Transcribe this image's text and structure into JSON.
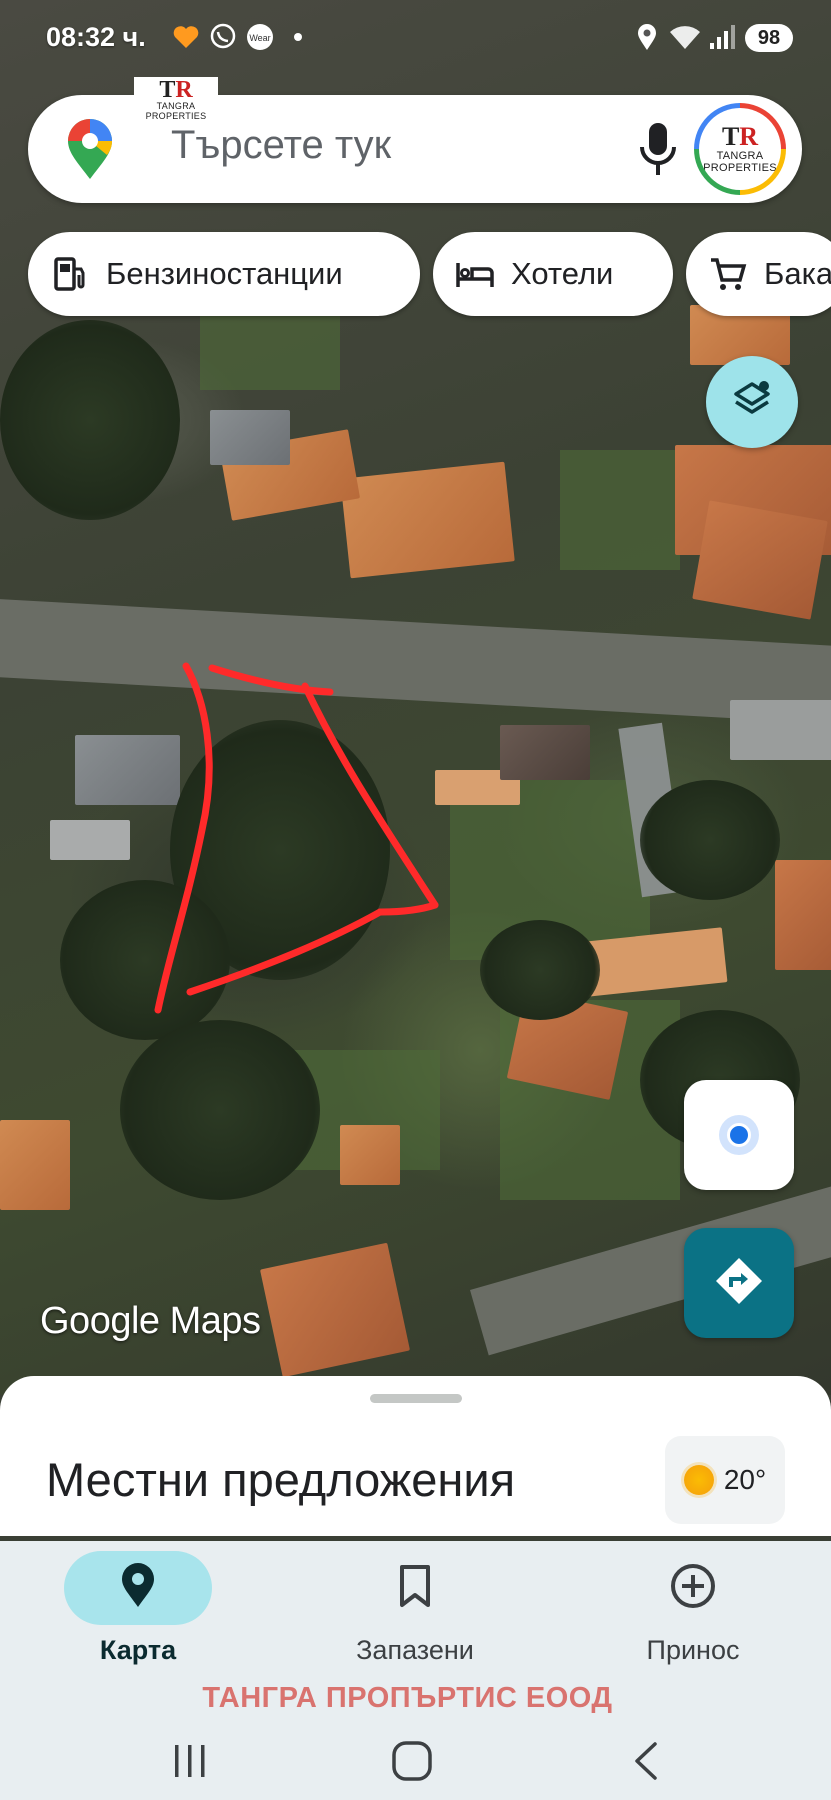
{
  "status_bar": {
    "time": "08:32 ч.",
    "icons": [
      "heart-app-icon",
      "viber-icon",
      "wear-icon",
      "dot-icon",
      "location-icon",
      "wifi-icon",
      "signal-icon"
    ],
    "battery": "98"
  },
  "search": {
    "placeholder": "Търсете тук",
    "icons": [
      "maps-pin-icon",
      "mic-icon"
    ],
    "avatar": {
      "mark_left": "T",
      "mark_right": "R",
      "brand": "TANGRA",
      "sub": "PROPERTIES"
    }
  },
  "overlay_logo": {
    "mark_left": "T",
    "mark_right": "R",
    "line1": "TANGRA",
    "line2": "PROPERTIES"
  },
  "chips": [
    {
      "label": "Бензиностанции",
      "icon": "gas-station-icon"
    },
    {
      "label": "Хотели",
      "icon": "bed-icon"
    },
    {
      "label": "Бака",
      "icon": "cart-icon"
    }
  ],
  "map": {
    "attribution": "Google Maps",
    "annotation_color": "#ff2a2a",
    "floating_buttons": [
      "layers-icon",
      "my-location-icon",
      "directions-icon"
    ]
  },
  "sheet": {
    "title": "Местни предложения",
    "weather_temp": "20°"
  },
  "bottom_nav": [
    {
      "label": "Карта",
      "icon": "pin-icon",
      "active": true
    },
    {
      "label": "Запазени",
      "icon": "bookmark-icon",
      "active": false
    },
    {
      "label": "Принос",
      "icon": "add-circle-icon",
      "active": false
    }
  ],
  "watermark": "ТАНГРА ПРОПЪРТИС  ЕООД",
  "colors": {
    "accent": "#0b7285",
    "nav_active": "#a8e4ec",
    "layers_btn": "#9ee3ea"
  }
}
